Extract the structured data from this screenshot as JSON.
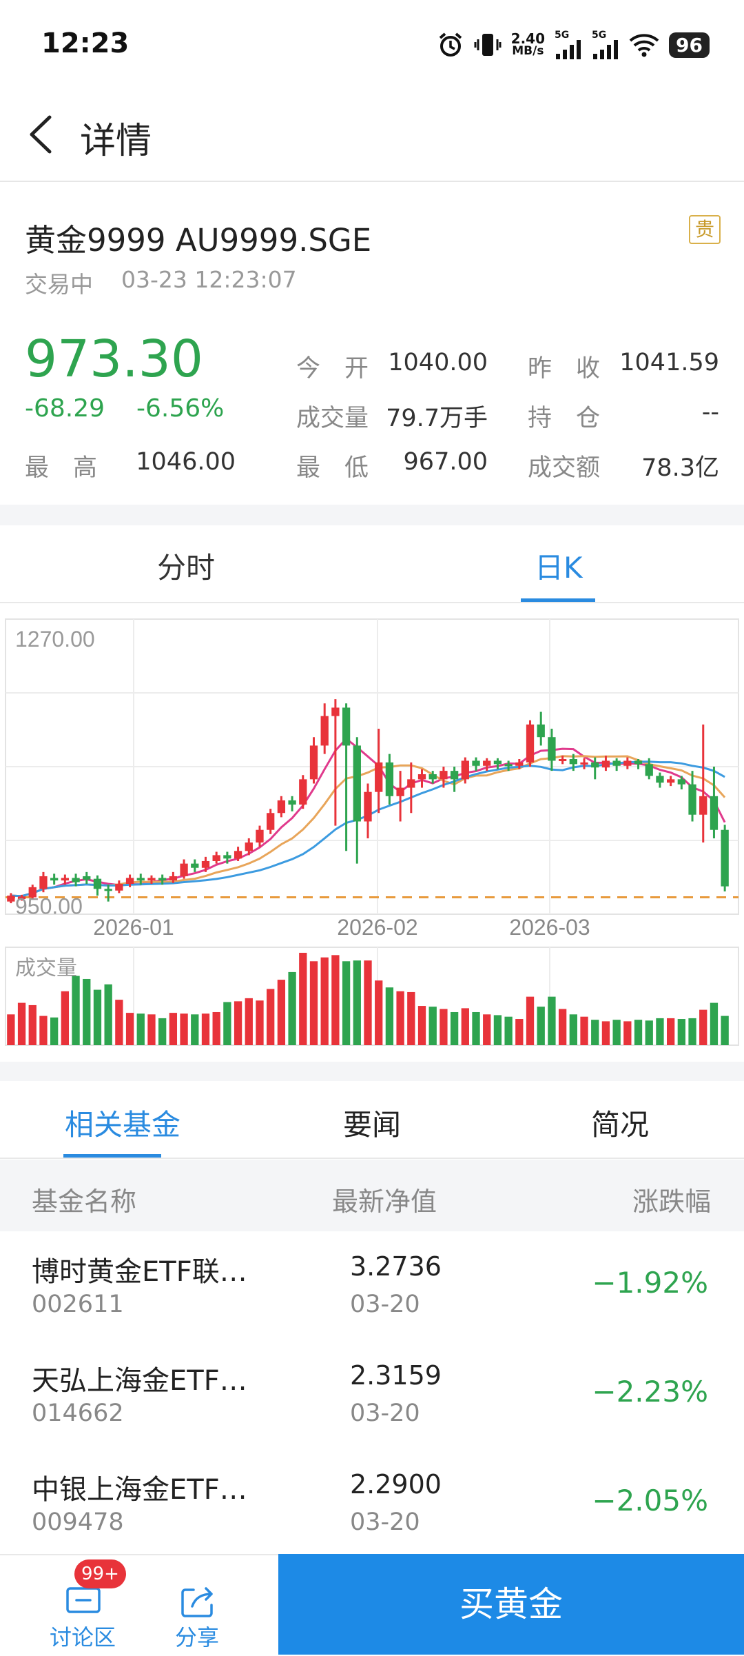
{
  "status_bar": {
    "time": "12:23",
    "net_speed_value": "2.40",
    "net_speed_unit": "MB/s",
    "sig1_label": "5G",
    "sig2_label": "5G",
    "battery": "96",
    "icons": [
      "alarm-icon",
      "vibrate-icon",
      "signal-icon",
      "signal-icon",
      "wifi-icon",
      "battery-icon"
    ]
  },
  "header": {
    "title": "详情",
    "back_icon": "chevron-left-icon"
  },
  "quote": {
    "name": "黄金9999 AU9999.SGE",
    "tag": "贵",
    "trade_status": "交易中",
    "trade_time": "03-23 12:23:07",
    "price": "973.30",
    "change": "-68.29",
    "change_pct": "-6.56%",
    "high_label": "最　高",
    "high": "1046.00",
    "open_label": "今　开",
    "open": "1040.00",
    "prev_close_label": "昨　收",
    "prev_close": "1041.59",
    "volume_label": "成交量",
    "volume": "79.7万手",
    "position_label": "持　仓",
    "position": "--",
    "low_label": "最　低",
    "low": "967.00",
    "turnover_label": "成交额",
    "turnover": "78.3亿",
    "up_color": "#e8333a",
    "down_color": "#2ea44f"
  },
  "chart_tabs": [
    {
      "label": "分时",
      "active": false
    },
    {
      "label": "日K",
      "active": true
    }
  ],
  "chart_data": {
    "type": "candlestick",
    "y_top_label": "1270.00",
    "y_bottom_label": "950.00",
    "ylim": [
      940,
      1290
    ],
    "x_labels": [
      "2026-01",
      "2026-02",
      "2026-03"
    ],
    "volume_label": "成交量",
    "reference_line": 960,
    "candles": [
      [
        955,
        962,
        953,
        965
      ],
      [
        958,
        961,
        956,
        963
      ],
      [
        960,
        972,
        958,
        975
      ],
      [
        970,
        985,
        966,
        990
      ],
      [
        983,
        980,
        975,
        988
      ],
      [
        980,
        983,
        975,
        987
      ],
      [
        983,
        978,
        973,
        988
      ],
      [
        985,
        981,
        976,
        990
      ],
      [
        982,
        970,
        962,
        986
      ],
      [
        970,
        968,
        955,
        975
      ],
      [
        968,
        976,
        965,
        980
      ],
      [
        976,
        983,
        972,
        987
      ],
      [
        983,
        980,
        975,
        988
      ],
      [
        980,
        983,
        976,
        986
      ],
      [
        983,
        980,
        975,
        987
      ],
      [
        980,
        985,
        977,
        990
      ],
      [
        985,
        1000,
        982,
        1005
      ],
      [
        1000,
        995,
        990,
        1005
      ],
      [
        995,
        1003,
        990,
        1008
      ],
      [
        1003,
        1010,
        1000,
        1014
      ],
      [
        1010,
        1006,
        1000,
        1014
      ],
      [
        1006,
        1015,
        1003,
        1020
      ],
      [
        1015,
        1025,
        1010,
        1030
      ],
      [
        1025,
        1040,
        1020,
        1045
      ],
      [
        1040,
        1060,
        1035,
        1065
      ],
      [
        1060,
        1075,
        1055,
        1080
      ],
      [
        1075,
        1070,
        1062,
        1080
      ],
      [
        1070,
        1100,
        1065,
        1105
      ],
      [
        1100,
        1140,
        1095,
        1150
      ],
      [
        1140,
        1175,
        1130,
        1190
      ],
      [
        1175,
        1185,
        1045,
        1195
      ],
      [
        1185,
        1140,
        1015,
        1190
      ],
      [
        1140,
        1050,
        1000,
        1150
      ],
      [
        1050,
        1085,
        1030,
        1095
      ],
      [
        1085,
        1120,
        1060,
        1160
      ],
      [
        1120,
        1080,
        1070,
        1130
      ],
      [
        1080,
        1090,
        1050,
        1110
      ],
      [
        1090,
        1100,
        1060,
        1120
      ],
      [
        1100,
        1106,
        1090,
        1112
      ],
      [
        1106,
        1100,
        1095,
        1110
      ],
      [
        1100,
        1110,
        1090,
        1115
      ],
      [
        1110,
        1100,
        1085,
        1115
      ],
      [
        1100,
        1122,
        1095,
        1126
      ],
      [
        1122,
        1116,
        1110,
        1126
      ],
      [
        1116,
        1122,
        1110,
        1125
      ],
      [
        1122,
        1118,
        1112,
        1125
      ],
      [
        1118,
        1116,
        1110,
        1122
      ],
      [
        1116,
        1120,
        1112,
        1124
      ],
      [
        1120,
        1165,
        1115,
        1170
      ],
      [
        1165,
        1150,
        1140,
        1180
      ],
      [
        1150,
        1122,
        1110,
        1160
      ],
      [
        1122,
        1124,
        1118,
        1128
      ],
      [
        1124,
        1118,
        1110,
        1130
      ],
      [
        1118,
        1120,
        1112,
        1125
      ],
      [
        1120,
        1114,
        1100,
        1126
      ],
      [
        1114,
        1122,
        1110,
        1128
      ],
      [
        1122,
        1116,
        1110,
        1125
      ],
      [
        1116,
        1122,
        1112,
        1126
      ],
      [
        1122,
        1118,
        1112,
        1124
      ],
      [
        1118,
        1104,
        1100,
        1125
      ],
      [
        1104,
        1096,
        1090,
        1108
      ],
      [
        1096,
        1100,
        1092,
        1104
      ],
      [
        1100,
        1094,
        1088,
        1104
      ],
      [
        1094,
        1058,
        1050,
        1110
      ],
      [
        1058,
        1080,
        1025,
        1165
      ],
      [
        1080,
        1040,
        1030,
        1115
      ],
      [
        1040,
        973,
        967,
        1046
      ]
    ],
    "ma_series": [
      {
        "name": "MA5",
        "color": "#e03a8c",
        "period": 5
      },
      {
        "name": "MA10",
        "color": "#e8a55a",
        "period": 10
      },
      {
        "name": "MA20",
        "color": "#3c9be0",
        "period": 20
      }
    ],
    "volumes": [
      40,
      55,
      52,
      38,
      36,
      70,
      90,
      86,
      72,
      79,
      59,
      42,
      41,
      40,
      35,
      42,
      41,
      40,
      41,
      43,
      56,
      57,
      61,
      58,
      73,
      85,
      95,
      120,
      109,
      114,
      117,
      109,
      110,
      110,
      84,
      75,
      70,
      69,
      51,
      50,
      47,
      43,
      48,
      43,
      40,
      39,
      37,
      34,
      63,
      50,
      63,
      47,
      40,
      37,
      33,
      31,
      33,
      31,
      33,
      32,
      35,
      35,
      34,
      35,
      46,
      55,
      38
    ]
  },
  "news_tabs": [
    {
      "label": "相关基金",
      "active": true
    },
    {
      "label": "要闻",
      "active": false
    },
    {
      "label": "简况",
      "active": false
    }
  ],
  "fund_table": {
    "headers": [
      "基金名称",
      "最新净值",
      "涨跌幅"
    ],
    "rows": [
      {
        "name": "博时黄金ETF联…",
        "code": "002611",
        "nav": "3.2736",
        "date": "03-20",
        "change": "−1.92%"
      },
      {
        "name": "天弘上海金ETF…",
        "code": "014662",
        "nav": "2.3159",
        "date": "03-20",
        "change": "−2.23%"
      },
      {
        "name": "中银上海金ETF…",
        "code": "009478",
        "nav": "2.2900",
        "date": "03-20",
        "change": "−2.05%"
      }
    ]
  },
  "bottom_bar": {
    "discuss_label": "讨论区",
    "discuss_badge": "99+",
    "share_label": "分享",
    "buy_label": "买黄金",
    "accent": "#1d8ae6"
  }
}
